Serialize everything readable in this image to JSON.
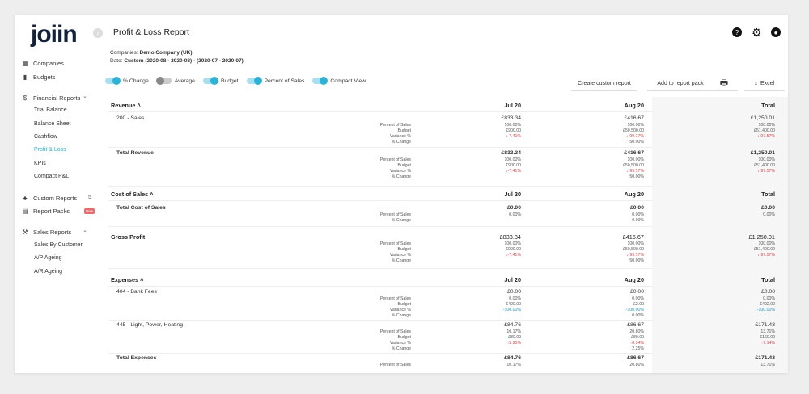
{
  "logo": "joiin",
  "page_title": "Profit & Loss Report",
  "meta": {
    "companies_label": "Companies:",
    "companies_value": "Demo Company (UK)",
    "date_label": "Date:",
    "date_value": "Custom (2020-08 - 2020-08) - (2020-07 - 2020-07)"
  },
  "sidebar": {
    "companies": "Companies",
    "budgets": "Budgets",
    "financial_reports": "Financial Reports",
    "fr_items": [
      "Trial Balance",
      "Balance Sheet",
      "Cashflow",
      "Profit & Loss",
      "KPIs",
      "Compact P&L"
    ],
    "custom_reports": "Custom Reports",
    "custom_reports_count": "5",
    "report_packs": "Report Packs",
    "report_packs_badge": "New",
    "sales_reports": "Sales Reports",
    "sr_items": [
      "Sales By Customer",
      "A/P Ageing",
      "A/R Ageing"
    ]
  },
  "toggles": {
    "pct_change": "% Change",
    "average": "Average",
    "budget": "Budget",
    "percent_of_sales": "Percent of Sales",
    "compact_view": "Compact View"
  },
  "buttons": {
    "create_custom": "Create custom report",
    "add_to_pack": "Add to report pack",
    "excel": "Excel"
  },
  "columns": {
    "c1": "Jul 20",
    "c2": "Aug 20",
    "c3": "Total"
  },
  "labels": {
    "pos": "Percent of Sales",
    "budget": "Budget",
    "variance": "Variance %",
    "change": "% Change"
  },
  "revenue": {
    "title": "Revenue",
    "sales": {
      "name": "200 - Sales",
      "jul": {
        "v": "£833.34",
        "pos": "100.00%",
        "budget": "£900.00",
        "var": "-7.41%"
      },
      "aug": {
        "v": "£416.67",
        "pos": "100.00%",
        "budget": "£50,500.00",
        "var": "-99.17%",
        "chg": "-50.00%"
      },
      "tot": {
        "v": "£1,250.01",
        "pos": "100.00%",
        "budget": "£51,400.00",
        "var": "-97.57%"
      }
    },
    "total": {
      "name": "Total Revenue",
      "jul": {
        "v": "£833.34",
        "pos": "100.00%",
        "budget": "£900.00",
        "var": "-7.41%"
      },
      "aug": {
        "v": "£416.67",
        "pos": "100.00%",
        "budget": "£50,500.00",
        "var": "-99.17%",
        "chg": "-50.00%"
      },
      "tot": {
        "v": "£1,250.01",
        "pos": "100.00%",
        "budget": "£51,400.00",
        "var": "-97.57%"
      }
    }
  },
  "cos": {
    "title": "Cost of Sales",
    "total_name": "Total Cost of Sales",
    "jul": {
      "v": "£0.00",
      "pos": "0.00%"
    },
    "aug": {
      "v": "£0.00",
      "pos": "0.00%",
      "chg": "0.00%"
    },
    "tot": {
      "v": "£0.00",
      "pos": "0.00%"
    }
  },
  "gp": {
    "title": "Gross Profit",
    "jul": {
      "v": "£833.34",
      "pos": "100.00%",
      "budget": "£900.00",
      "var": "-7.41%"
    },
    "aug": {
      "v": "£416.67",
      "pos": "100.00%",
      "budget": "£50,500.00",
      "var": "-99.17%",
      "chg": "-50.00%"
    },
    "tot": {
      "v": "£1,250.01",
      "pos": "100.00%",
      "budget": "£51,400.00",
      "var": "-97.57%"
    }
  },
  "expenses": {
    "title": "Expenses",
    "bank": {
      "name": "404 - Bank Fees",
      "jul": {
        "v": "£0.00",
        "pos": "0.00%",
        "budget": "£400.00",
        "var": "-100.00%"
      },
      "aug": {
        "v": "£0.00",
        "pos": "0.00%",
        "budget": "£2.00",
        "var": "-100.00%",
        "chg": "0.00%"
      },
      "tot": {
        "v": "£0.00",
        "pos": "0.00%",
        "budget": "£402.00",
        "var": "-100.00%"
      }
    },
    "light": {
      "name": "445 - Light, Power, Heating",
      "jul": {
        "v": "£84.76",
        "pos": "10.17%",
        "budget": "£80.00",
        "var": "5.95%"
      },
      "aug": {
        "v": "£86.67",
        "pos": "20.80%",
        "budget": "£80.00",
        "var": "8.34%",
        "chg": "2.25%"
      },
      "tot": {
        "v": "£171.43",
        "pos": "13.71%",
        "budget": "£160.00",
        "var": "7.14%"
      }
    },
    "total": {
      "name": "Total Expenses",
      "jul": {
        "v": "£84.76",
        "pos": "10.17%"
      },
      "aug": {
        "v": "£86.67",
        "pos": "20.80%"
      },
      "tot": {
        "v": "£171.43",
        "pos": "13.71%"
      }
    }
  }
}
